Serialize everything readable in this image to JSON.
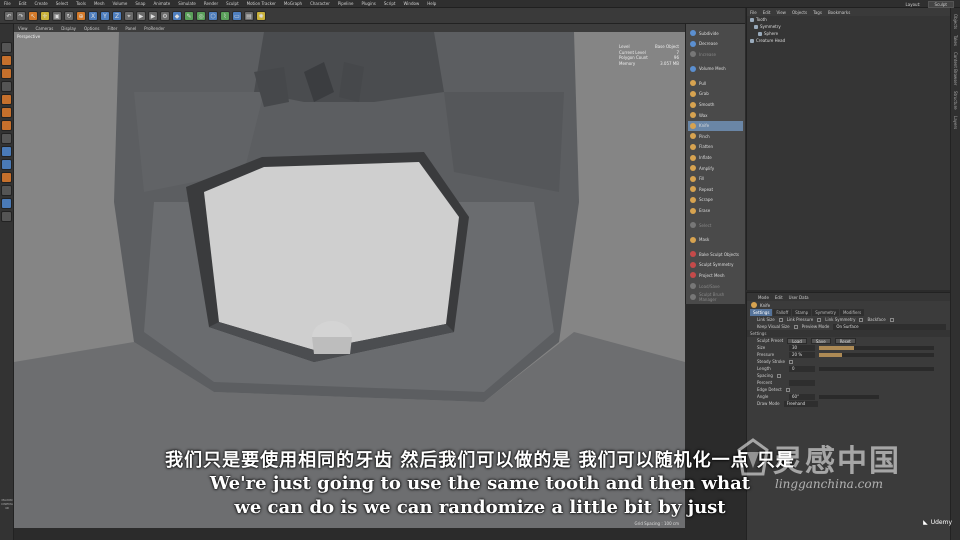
{
  "menubar": {
    "items": [
      "File",
      "Edit",
      "Create",
      "Select",
      "Tools",
      "Mesh",
      "Volume",
      "Snap",
      "Animate",
      "Simulate",
      "Render",
      "Sculpt",
      "Motion Tracker",
      "MoGraph",
      "Character",
      "Pipeline",
      "Plugins",
      "Script",
      "Window",
      "Help"
    ],
    "layout_label": "Layout:",
    "layout_value": "Sculpt"
  },
  "viewport": {
    "menu": [
      "View",
      "Cameras",
      "Display",
      "Options",
      "Filter",
      "Panel",
      "ProRender"
    ],
    "label": "Perspective",
    "stats": [
      {
        "k": "Level",
        "v": "Base Object"
      },
      {
        "k": "Current Level",
        "v": "7"
      },
      {
        "k": "Polygon Count",
        "v": "96"
      },
      {
        "k": "Memory",
        "v": "3.057 MB"
      }
    ],
    "grid_spacing": "Grid Spacing : 100 cm"
  },
  "brushes": {
    "group1": [
      "Subdivide",
      "Decrease",
      "Increase"
    ],
    "volume_mesh": "Volume Mesh",
    "group2": [
      "Pull",
      "Grab",
      "Smooth",
      "Wax",
      "Knife",
      "Pinch",
      "Flatten",
      "Inflate",
      "Amplify",
      "Fill",
      "Repeat",
      "Scrape",
      "Erase"
    ],
    "selected": "Knife",
    "group3": [
      "Select"
    ],
    "group4": [
      "Mask"
    ],
    "group5": [
      "Bake Sculpt Objects",
      "Sculpt Symmetry",
      "Project Mesh",
      "Load/Save",
      "Sculpt Brush Manager"
    ]
  },
  "object_manager": {
    "menu": [
      "File",
      "Edit",
      "View",
      "Objects",
      "Tags",
      "Bookmarks"
    ],
    "objects": [
      "Tooth",
      "Symmetry",
      "Sphere",
      "Creature Head"
    ]
  },
  "side_tabs": [
    "Objects",
    "Takes",
    "Content Browser",
    "Structure",
    "Layers"
  ],
  "attributes": {
    "menu": [
      "Mode",
      "Edit",
      "User Data"
    ],
    "tool": "Knife",
    "tabs": [
      "Settings",
      "Falloff",
      "Stamp",
      "Symmetry",
      "Modifiers"
    ],
    "active_tab": "Settings",
    "options_row1": [
      "Link Size",
      "Link Pressure",
      "Link Symmetry",
      "Backface"
    ],
    "keep_visual_size": "Keep Visual Size",
    "preview_mode_label": "Preview Mode",
    "preview_mode_value": "On Surface",
    "settings_header": "Settings",
    "sculpt_preset": "Sculpt Preset",
    "preset_buttons": [
      "Load",
      "Save",
      "Reset"
    ],
    "size_label": "Size",
    "size_value": "30",
    "pressure_label": "Pressure",
    "pressure_value": "20 %",
    "size_level": 0.3,
    "pressure_level": 0.2,
    "steady_stroke": "Steady Stroke",
    "length_label": "Length",
    "length_value": "0",
    "spacing": "Spacing",
    "percent_label": "Percent",
    "edge_detect": "Edge Detect",
    "angle_label": "Angle",
    "angle_value": "60°",
    "draw_mode_label": "Draw Mode",
    "draw_mode_value": "Freehand"
  },
  "subtitles": {
    "cn": "我们只是要使用相同的牙齿 然后我们可以做的是 我们可以随机化一点 只是",
    "en_line1": "We're just going to use the same tooth and then what",
    "en_line2": "we can do is we can randomize a little bit by just"
  },
  "watermark": {
    "cn": "灵感中国",
    "url": "lingganchina.com"
  },
  "udemy": "Udemy",
  "maxon_logo": "MAXON CINEMA 4D"
}
